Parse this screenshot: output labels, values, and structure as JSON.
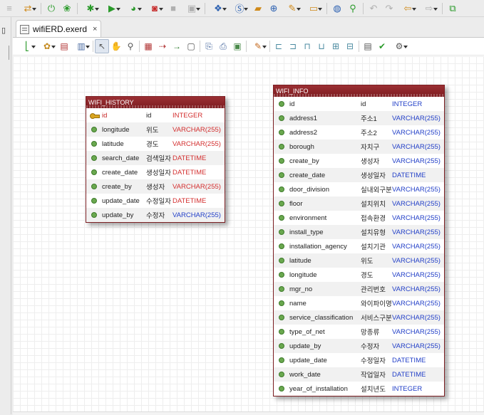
{
  "tab": {
    "filename": "wifiERD.exerd",
    "close_glyph": "×"
  },
  "icons": {
    "top_toolbar": [
      "list-icon",
      "sync-icon",
      "power-icon",
      "spring-icon",
      "debug-icon",
      "run-icon",
      "profile-icon",
      "coverage-icon",
      "stop-icon",
      "deploy-icon",
      "new-class-icon",
      "new-element-icon",
      "open-folder-icon",
      "open-type-icon",
      "build-icon",
      "open-icon",
      "globe-icon",
      "search-icon",
      "back-icon",
      "forward-icon",
      "prev-edit-icon",
      "next-edit-icon",
      "maximize-icon"
    ],
    "editor_toolbar": [
      "layer-icon",
      "palette-icon",
      "note-icon",
      "page-icon",
      "select-pointer-icon",
      "hand-icon",
      "zoom-icon",
      "table-icon",
      "relation-icon",
      "fk-icon",
      "comment-icon",
      "copy-icon",
      "print-icon",
      "image-icon",
      "color-icon",
      "align-left-icon",
      "align-center-icon",
      "align-right-icon",
      "align-top-icon",
      "align-middle-icon",
      "align-bottom-icon",
      "document-icon",
      "check-icon",
      "settings-icon"
    ]
  },
  "colors": {
    "entity_header": "#8b2428",
    "pk_text": "#c62828",
    "type_blue": "#2340c8",
    "type_red": "#d32f2f",
    "dot_green": "#6aa84f"
  },
  "entities": [
    {
      "name": "WIFI_HISTORY",
      "columns": [
        {
          "physical": "id",
          "logical": "id",
          "type": "INTEGER",
          "pk": true
        },
        {
          "physical": "longitude",
          "logical": "위도",
          "type": "VARCHAR(255)"
        },
        {
          "physical": "latitude",
          "logical": "경도",
          "type": "VARCHAR(255)"
        },
        {
          "physical": "search_date",
          "logical": "검색일자",
          "type": "DATETIME"
        },
        {
          "physical": "create_date",
          "logical": "생성일자",
          "type": "DATETIME"
        },
        {
          "physical": "create_by",
          "logical": "생성자",
          "type": "VARCHAR(255)"
        },
        {
          "physical": "update_date",
          "logical": "수정일자",
          "type": "DATETIME"
        },
        {
          "physical": "update_by",
          "logical": "수정자",
          "type": "VARCHAR(255)"
        }
      ]
    },
    {
      "name": "WIFI_INFO",
      "columns": [
        {
          "physical": "id",
          "logical": "id",
          "type": "INTEGER"
        },
        {
          "physical": "address1",
          "logical": "주소1",
          "type": "VARCHAR(255)"
        },
        {
          "physical": "address2",
          "logical": "주소2",
          "type": "VARCHAR(255)"
        },
        {
          "physical": "borough",
          "logical": "자치구",
          "type": "VARCHAR(255)"
        },
        {
          "physical": "create_by",
          "logical": "생성자",
          "type": "VARCHAR(255)"
        },
        {
          "physical": "create_date",
          "logical": "생성일자",
          "type": "DATETIME"
        },
        {
          "physical": "door_division",
          "logical": "실내외구분",
          "type": "VARCHAR(255)"
        },
        {
          "physical": "floor",
          "logical": "설치위치",
          "type": "VARCHAR(255)"
        },
        {
          "physical": "environment",
          "logical": "접속환경",
          "type": "VARCHAR(255)"
        },
        {
          "physical": "install_type",
          "logical": "설치유형",
          "type": "VARCHAR(255)"
        },
        {
          "physical": "installation_agency",
          "logical": "설치기관",
          "type": "VARCHAR(255)"
        },
        {
          "physical": "latitude",
          "logical": "위도",
          "type": "VARCHAR(255)"
        },
        {
          "physical": "longitude",
          "logical": "경도",
          "type": "VARCHAR(255)"
        },
        {
          "physical": "mgr_no",
          "logical": "관리번호",
          "type": "VARCHAR(255)"
        },
        {
          "physical": "name",
          "logical": "와이파이명",
          "type": "VARCHAR(255)"
        },
        {
          "physical": "service_classification",
          "logical": "서비스구분",
          "type": "VARCHAR(255)"
        },
        {
          "physical": "type_of_net",
          "logical": "망종류",
          "type": "VARCHAR(255)"
        },
        {
          "physical": "update_by",
          "logical": "수정자",
          "type": "VARCHAR(255)"
        },
        {
          "physical": "update_date",
          "logical": "수정일자",
          "type": "DATETIME"
        },
        {
          "physical": "work_date",
          "logical": "작업일자",
          "type": "DATETIME"
        },
        {
          "physical": "year_of_installation",
          "logical": "설치년도",
          "type": "INTEGER"
        }
      ]
    }
  ]
}
